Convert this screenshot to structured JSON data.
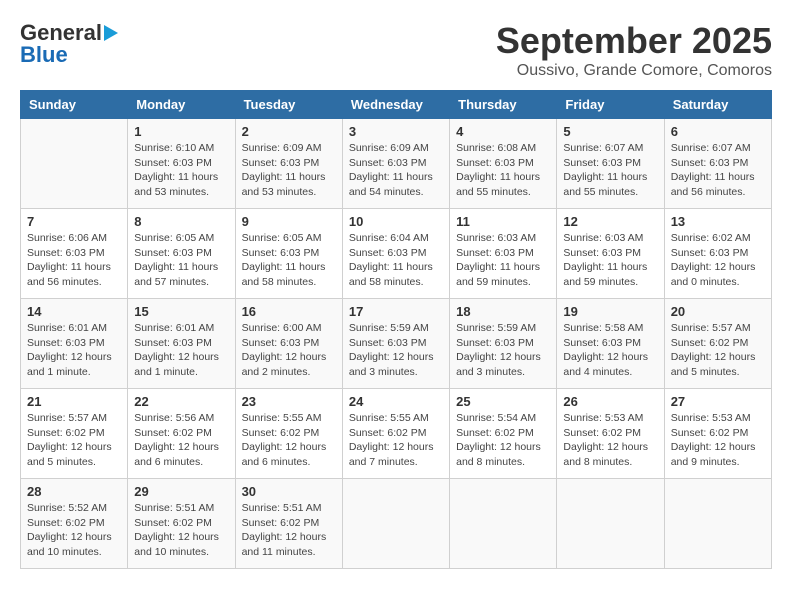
{
  "logo": {
    "line1": "General",
    "line2": "Blue"
  },
  "title": "September 2025",
  "subtitle": "Oussivo, Grande Comore, Comoros",
  "weekdays": [
    "Sunday",
    "Monday",
    "Tuesday",
    "Wednesday",
    "Thursday",
    "Friday",
    "Saturday"
  ],
  "weeks": [
    [
      {
        "day": "",
        "sunrise": "",
        "sunset": "",
        "daylight": ""
      },
      {
        "day": "1",
        "sunrise": "Sunrise: 6:10 AM",
        "sunset": "Sunset: 6:03 PM",
        "daylight": "Daylight: 11 hours and 53 minutes."
      },
      {
        "day": "2",
        "sunrise": "Sunrise: 6:09 AM",
        "sunset": "Sunset: 6:03 PM",
        "daylight": "Daylight: 11 hours and 53 minutes."
      },
      {
        "day": "3",
        "sunrise": "Sunrise: 6:09 AM",
        "sunset": "Sunset: 6:03 PM",
        "daylight": "Daylight: 11 hours and 54 minutes."
      },
      {
        "day": "4",
        "sunrise": "Sunrise: 6:08 AM",
        "sunset": "Sunset: 6:03 PM",
        "daylight": "Daylight: 11 hours and 55 minutes."
      },
      {
        "day": "5",
        "sunrise": "Sunrise: 6:07 AM",
        "sunset": "Sunset: 6:03 PM",
        "daylight": "Daylight: 11 hours and 55 minutes."
      },
      {
        "day": "6",
        "sunrise": "Sunrise: 6:07 AM",
        "sunset": "Sunset: 6:03 PM",
        "daylight": "Daylight: 11 hours and 56 minutes."
      }
    ],
    [
      {
        "day": "7",
        "sunrise": "Sunrise: 6:06 AM",
        "sunset": "Sunset: 6:03 PM",
        "daylight": "Daylight: 11 hours and 56 minutes."
      },
      {
        "day": "8",
        "sunrise": "Sunrise: 6:05 AM",
        "sunset": "Sunset: 6:03 PM",
        "daylight": "Daylight: 11 hours and 57 minutes."
      },
      {
        "day": "9",
        "sunrise": "Sunrise: 6:05 AM",
        "sunset": "Sunset: 6:03 PM",
        "daylight": "Daylight: 11 hours and 58 minutes."
      },
      {
        "day": "10",
        "sunrise": "Sunrise: 6:04 AM",
        "sunset": "Sunset: 6:03 PM",
        "daylight": "Daylight: 11 hours and 58 minutes."
      },
      {
        "day": "11",
        "sunrise": "Sunrise: 6:03 AM",
        "sunset": "Sunset: 6:03 PM",
        "daylight": "Daylight: 11 hours and 59 minutes."
      },
      {
        "day": "12",
        "sunrise": "Sunrise: 6:03 AM",
        "sunset": "Sunset: 6:03 PM",
        "daylight": "Daylight: 11 hours and 59 minutes."
      },
      {
        "day": "13",
        "sunrise": "Sunrise: 6:02 AM",
        "sunset": "Sunset: 6:03 PM",
        "daylight": "Daylight: 12 hours and 0 minutes."
      }
    ],
    [
      {
        "day": "14",
        "sunrise": "Sunrise: 6:01 AM",
        "sunset": "Sunset: 6:03 PM",
        "daylight": "Daylight: 12 hours and 1 minute."
      },
      {
        "day": "15",
        "sunrise": "Sunrise: 6:01 AM",
        "sunset": "Sunset: 6:03 PM",
        "daylight": "Daylight: 12 hours and 1 minute."
      },
      {
        "day": "16",
        "sunrise": "Sunrise: 6:00 AM",
        "sunset": "Sunset: 6:03 PM",
        "daylight": "Daylight: 12 hours and 2 minutes."
      },
      {
        "day": "17",
        "sunrise": "Sunrise: 5:59 AM",
        "sunset": "Sunset: 6:03 PM",
        "daylight": "Daylight: 12 hours and 3 minutes."
      },
      {
        "day": "18",
        "sunrise": "Sunrise: 5:59 AM",
        "sunset": "Sunset: 6:03 PM",
        "daylight": "Daylight: 12 hours and 3 minutes."
      },
      {
        "day": "19",
        "sunrise": "Sunrise: 5:58 AM",
        "sunset": "Sunset: 6:03 PM",
        "daylight": "Daylight: 12 hours and 4 minutes."
      },
      {
        "day": "20",
        "sunrise": "Sunrise: 5:57 AM",
        "sunset": "Sunset: 6:02 PM",
        "daylight": "Daylight: 12 hours and 5 minutes."
      }
    ],
    [
      {
        "day": "21",
        "sunrise": "Sunrise: 5:57 AM",
        "sunset": "Sunset: 6:02 PM",
        "daylight": "Daylight: 12 hours and 5 minutes."
      },
      {
        "day": "22",
        "sunrise": "Sunrise: 5:56 AM",
        "sunset": "Sunset: 6:02 PM",
        "daylight": "Daylight: 12 hours and 6 minutes."
      },
      {
        "day": "23",
        "sunrise": "Sunrise: 5:55 AM",
        "sunset": "Sunset: 6:02 PM",
        "daylight": "Daylight: 12 hours and 6 minutes."
      },
      {
        "day": "24",
        "sunrise": "Sunrise: 5:55 AM",
        "sunset": "Sunset: 6:02 PM",
        "daylight": "Daylight: 12 hours and 7 minutes."
      },
      {
        "day": "25",
        "sunrise": "Sunrise: 5:54 AM",
        "sunset": "Sunset: 6:02 PM",
        "daylight": "Daylight: 12 hours and 8 minutes."
      },
      {
        "day": "26",
        "sunrise": "Sunrise: 5:53 AM",
        "sunset": "Sunset: 6:02 PM",
        "daylight": "Daylight: 12 hours and 8 minutes."
      },
      {
        "day": "27",
        "sunrise": "Sunrise: 5:53 AM",
        "sunset": "Sunset: 6:02 PM",
        "daylight": "Daylight: 12 hours and 9 minutes."
      }
    ],
    [
      {
        "day": "28",
        "sunrise": "Sunrise: 5:52 AM",
        "sunset": "Sunset: 6:02 PM",
        "daylight": "Daylight: 12 hours and 10 minutes."
      },
      {
        "day": "29",
        "sunrise": "Sunrise: 5:51 AM",
        "sunset": "Sunset: 6:02 PM",
        "daylight": "Daylight: 12 hours and 10 minutes."
      },
      {
        "day": "30",
        "sunrise": "Sunrise: 5:51 AM",
        "sunset": "Sunset: 6:02 PM",
        "daylight": "Daylight: 12 hours and 11 minutes."
      },
      {
        "day": "",
        "sunrise": "",
        "sunset": "",
        "daylight": ""
      },
      {
        "day": "",
        "sunrise": "",
        "sunset": "",
        "daylight": ""
      },
      {
        "day": "",
        "sunrise": "",
        "sunset": "",
        "daylight": ""
      },
      {
        "day": "",
        "sunrise": "",
        "sunset": "",
        "daylight": ""
      }
    ]
  ]
}
